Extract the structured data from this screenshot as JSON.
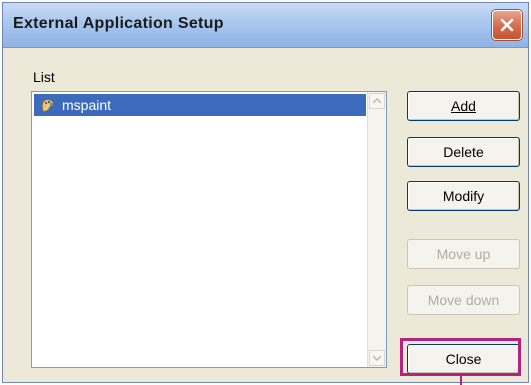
{
  "window": {
    "title": "External Application Setup",
    "close_icon": "close-icon"
  },
  "list": {
    "label": "List",
    "items": [
      {
        "label": "mspaint",
        "icon": "paint-icon",
        "selected": true
      }
    ]
  },
  "buttons": {
    "add": "Add",
    "delete": "Delete",
    "modify": "Modify",
    "move_up": "Move up",
    "move_down": "Move down",
    "close": "Close"
  },
  "colors": {
    "selection": "#3c6bbd",
    "highlight_frame": "#b4237d"
  }
}
